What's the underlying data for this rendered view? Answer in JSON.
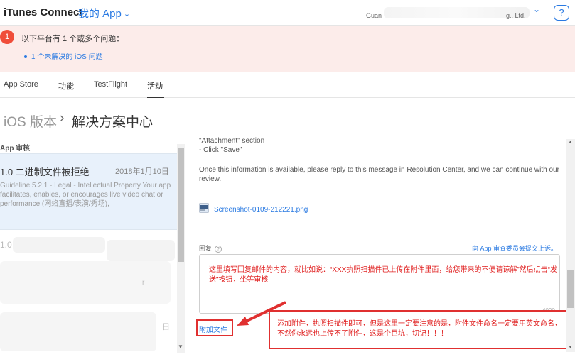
{
  "header": {
    "brand": "iTunes Connect",
    "my_app": "我的 App",
    "account_prefix": "Guan",
    "account_suffix": "g., Ltd.",
    "help": "?"
  },
  "banner": {
    "badge": "1",
    "title": "以下平台有 1 个或多个问题：",
    "link": "1 个未解决的 iOS 问题"
  },
  "tabs": [
    "App Store",
    "功能",
    "TestFlight",
    "活动"
  ],
  "breadcrumb": {
    "first": "iOS 版本",
    "separator": "›",
    "second": "解决方案中心"
  },
  "list": {
    "section": "App 审核",
    "item1": {
      "title": "1.0 二进制文件被拒绝",
      "date": "2018年1月10日",
      "body": "Guideline 5.2.1 - Legal - Intellectual Property Your app facilitates, enables, or encourages live video chat or performance (网络直播/表演/秀场),"
    },
    "item2_fragment": "1.0",
    "item2_date_fragment": "日",
    "item2_r": "r"
  },
  "message": {
    "line_a": "\"Attachment\" section",
    "line_b": "- Click \"Save\"",
    "line_c": "Once this information is available, please reply to this message in Resolution Center, and we can continue with our review.",
    "attachment": "Screenshot-0109-212221.png"
  },
  "reply": {
    "label": "回复",
    "q": "?",
    "appeal_link": "向 App 审查委员会提交上诉。",
    "note": "这里填写回复邮件的内容，就比如说：“XXX执照扫描件已上传在附件里面，给您带来的不便请谅解”然后点击“发送”按钮，坐等审核",
    "counter": "4000",
    "attach_button": "附加文件",
    "attach_note": "添加附件，执照扫描件即可，但是这里一定要注意的是，附件文件命名一定要用英文命名，不然你永远也上传不了附件，这是个巨坑，切记！！！"
  },
  "colors": {
    "accent": "#2a7ae2",
    "alert": "#f04d3a",
    "annotation": "#e02020"
  }
}
